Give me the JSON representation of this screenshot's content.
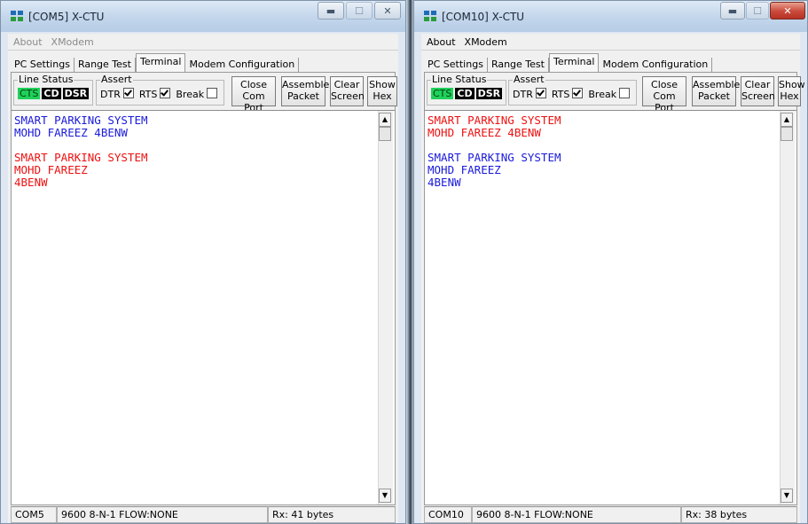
{
  "windows": {
    "left": {
      "title": "[COM5] X-CTU",
      "menu": {
        "about": "About",
        "xmodem": "XModem"
      },
      "tabs": [
        "PC Settings",
        "Range Test",
        "Terminal",
        "Modem Configuration"
      ],
      "line_status": {
        "label": "Line Status",
        "cts": "CTS",
        "cd": "CD",
        "dsr": "DSR"
      },
      "assert": {
        "label": "Assert",
        "dtr": "DTR",
        "rts": "RTS",
        "break": "Break"
      },
      "buttons": {
        "close_port_1": "Close",
        "close_port_2": "Com Port",
        "assemble_1": "Assemble",
        "assemble_2": "Packet",
        "clear_1": "Clear",
        "clear_2": "Screen",
        "hex_1": "Show",
        "hex_2": "Hex"
      },
      "terminal_lines": [
        {
          "text": "SMART PARKING SYSTEM",
          "color": "#1a1adc"
        },
        {
          "text": "MOHD FAREEZ 4BENW",
          "color": "#1a1adc"
        },
        {
          "text": "",
          "color": "#000000"
        },
        {
          "text": "SMART PARKING SYSTEM",
          "color": "#ee1111"
        },
        {
          "text": "MOHD FAREEZ",
          "color": "#ee1111"
        },
        {
          "text": "4BENW",
          "color": "#ee1111"
        }
      ],
      "status": {
        "port": "COM5",
        "settings": "9600 8-N-1  FLOW:NONE",
        "rx": "Rx: 41 bytes"
      }
    },
    "right": {
      "title": "[COM10] X-CTU",
      "menu": {
        "about": "About",
        "xmodem": "XModem"
      },
      "tabs": [
        "PC Settings",
        "Range Test",
        "Terminal",
        "Modem Configuration"
      ],
      "line_status": {
        "label": "Line Status",
        "cts": "CTS",
        "cd": "CD",
        "dsr": "DSR"
      },
      "assert": {
        "label": "Assert",
        "dtr": "DTR",
        "rts": "RTS",
        "break": "Break"
      },
      "buttons": {
        "close_port_1": "Close",
        "close_port_2": "Com Port",
        "assemble_1": "Assemble",
        "assemble_2": "Packet",
        "clear_1": "Clear",
        "clear_2": "Screen",
        "hex_1": "Show",
        "hex_2": "Hex"
      },
      "terminal_lines": [
        {
          "text": "SMART PARKING SYSTEM",
          "color": "#ee1111"
        },
        {
          "text": "MOHD FAREEZ 4BENW",
          "color": "#ee1111"
        },
        {
          "text": "",
          "color": "#000000"
        },
        {
          "text": "SMART PARKING SYSTEM",
          "color": "#1a1adc"
        },
        {
          "text": "MOHD FAREEZ",
          "color": "#1a1adc"
        },
        {
          "text": "4BENW",
          "color": "#1a1adc"
        }
      ],
      "status": {
        "port": "COM10",
        "settings": "9600 8-N-1  FLOW:NONE",
        "rx": "Rx: 38 bytes"
      }
    }
  },
  "colors": {
    "indicator_on": "#1ed25a",
    "indicator_off": "#000000",
    "sent_text": "#1a1adc",
    "received_text": "#ee1111"
  }
}
